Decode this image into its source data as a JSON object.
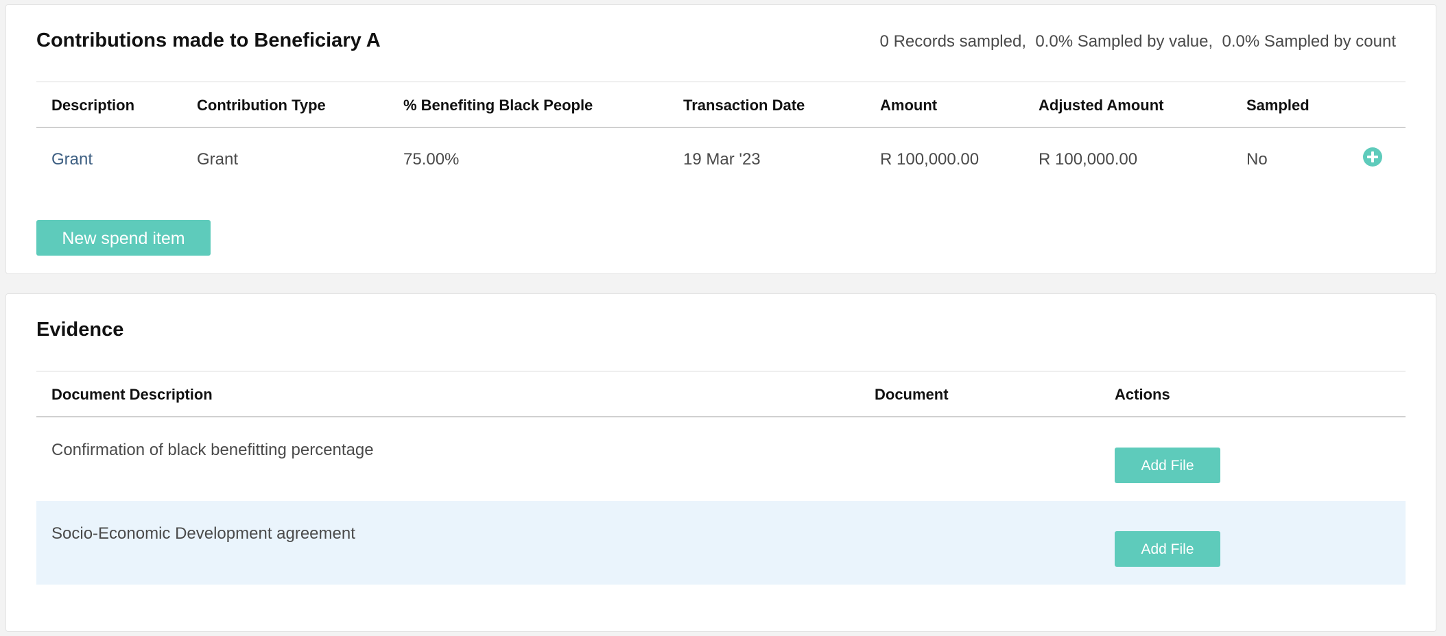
{
  "contributions": {
    "title": "Contributions made to Beneficiary A",
    "summary": {
      "records": "0 Records sampled,",
      "by_value": "0.0% Sampled by value,",
      "by_count": "0.0% Sampled by count"
    },
    "columns": {
      "description": "Description",
      "contribution_type": "Contribution Type",
      "benefiting": "% Benefiting Black People",
      "transaction_date": "Transaction Date",
      "amount": "Amount",
      "adjusted_amount": "Adjusted Amount",
      "sampled": "Sampled"
    },
    "rows": [
      {
        "description": "Grant",
        "contribution_type": "Grant",
        "benefiting": "75.00%",
        "transaction_date": "19 Mar '23",
        "amount": "R 100,000.00",
        "adjusted_amount": "R 100,000.00",
        "sampled": "No",
        "action_icon": "plus-circle-icon"
      }
    ],
    "new_button_label": "New spend item"
  },
  "evidence": {
    "title": "Evidence",
    "columns": {
      "document_description": "Document Description",
      "document": "Document",
      "actions": "Actions"
    },
    "rows": [
      {
        "document_description": "Confirmation of black benefitting percentage",
        "document": "",
        "action_label": "Add File"
      },
      {
        "document_description": "Socio-Economic Development agreement",
        "document": "",
        "action_label": "Add File"
      }
    ]
  },
  "colors": {
    "accent": "#5ecbbb",
    "link": "#3d5f82",
    "row_highlight": "#eaf4fc",
    "page_background": "#f3f3f3"
  }
}
